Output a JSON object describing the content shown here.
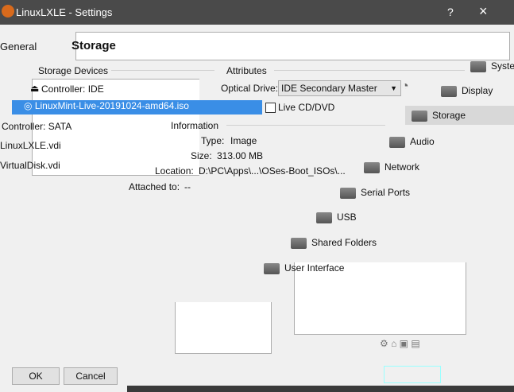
{
  "window": {
    "title": "LinuxLXLE - Settings",
    "help": "?",
    "close": "×"
  },
  "header": {
    "left_section": "General",
    "section_title": "Storage"
  },
  "storage_devices": {
    "label": "Storage Devices",
    "items": [
      {
        "label": "Controller: IDE",
        "kind": "controller"
      },
      {
        "label": "LinuxMint-Live-20191024-amd64.iso",
        "kind": "optical",
        "selected": true
      },
      {
        "label": "Controller: SATA",
        "kind": "controller"
      },
      {
        "label": "LinuxLXLE.vdi",
        "kind": "disk"
      },
      {
        "label": "VirtualDisk.vdi",
        "kind": "disk"
      }
    ]
  },
  "attributes": {
    "label": "Attributes",
    "optical_drive_label": "Optical Drive:",
    "optical_drive_value": "IDE Secondary Master",
    "live_cd_label": "Live CD/DVD",
    "live_cd_checked": false
  },
  "information": {
    "label": "Information",
    "type_label": "Type:",
    "type_value": "Image",
    "size_label": "Size:",
    "size_value": "313.00 MB",
    "location_label": "Location:",
    "location_value": "D:\\PC\\Apps\\...\\OSes-Boot_ISOs\\...",
    "attached_label": "Attached to:",
    "attached_value": "--"
  },
  "nav": [
    {
      "label": "System"
    },
    {
      "label": "Display"
    },
    {
      "label": "Storage",
      "selected": true
    },
    {
      "label": "Audio"
    },
    {
      "label": "Network"
    },
    {
      "label": "Serial Ports"
    },
    {
      "label": "USB"
    },
    {
      "label": "Shared Folders"
    },
    {
      "label": "User Interface"
    }
  ],
  "buttons": {
    "ok": "OK",
    "cancel": "Cancel"
  }
}
